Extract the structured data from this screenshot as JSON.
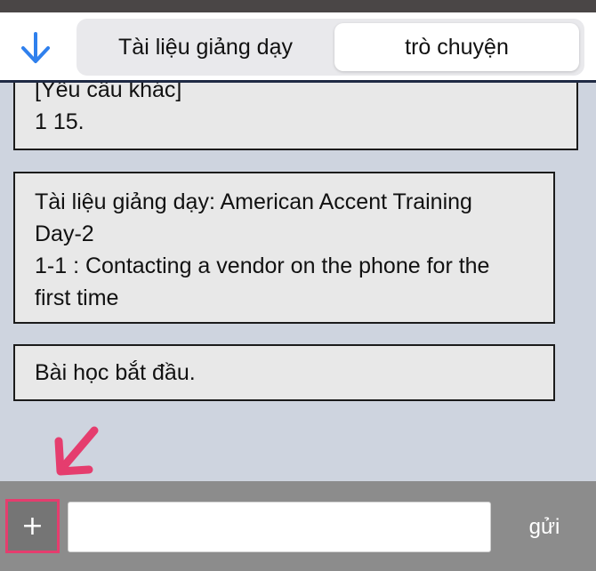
{
  "header": {
    "back_icon": "arrow-down-icon",
    "tabs": [
      {
        "label": "Tài liệu giảng dạy",
        "selected": false
      },
      {
        "label": "trò chuyện",
        "selected": true
      }
    ]
  },
  "messages": [
    {
      "lines": [
        "[Yêu cầu khác]",
        "1 15."
      ]
    },
    {
      "lines": [
        "Tài liệu giảng dạy: American Accent Training",
        "Day-2",
        "1-1 : Contacting a vendor on the phone for the",
        "first time"
      ]
    },
    {
      "lines": [
        "Bài học bắt đầu."
      ]
    }
  ],
  "composer": {
    "plus_icon": "plus-icon",
    "input_value": "",
    "input_placeholder": "",
    "send_label": "gửi"
  },
  "colors": {
    "accent": "#2f80ed",
    "highlight": "#e53d6e",
    "bottom_bar": "#8c8c8c",
    "chat_background": "#ced4df"
  }
}
